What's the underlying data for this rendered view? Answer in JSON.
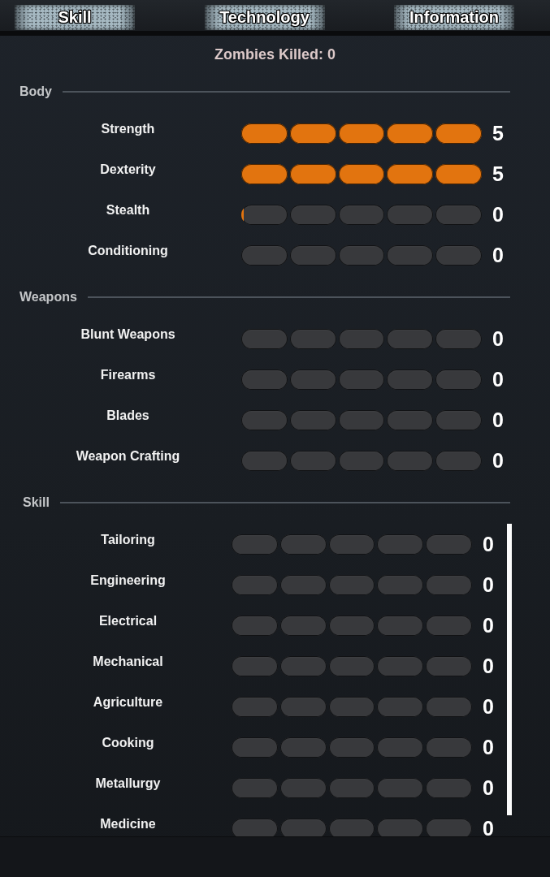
{
  "tabs": [
    {
      "label": "Skill"
    },
    {
      "label": "Technology"
    },
    {
      "label": "Information"
    }
  ],
  "zombies_killed": "Zombies Killed: 0",
  "sections": [
    {
      "title": "Body",
      "scrollbar": false,
      "skills": [
        {
          "name": "Strength",
          "stars": 5,
          "value": "5"
        },
        {
          "name": "Dexterity",
          "stars": 5,
          "value": "5"
        },
        {
          "name": "Stealth",
          "stars": 0,
          "level": 0.05,
          "value": "0"
        },
        {
          "name": "Conditioning",
          "stars": 0,
          "value": "0"
        }
      ]
    },
    {
      "title": "Weapons",
      "scrollbar": false,
      "skills": [
        {
          "name": "Blunt Weapons",
          "stars": 0,
          "value": "0"
        },
        {
          "name": "Firearms",
          "stars": 0,
          "value": "0"
        },
        {
          "name": "Blades",
          "stars": 0,
          "value": "0"
        },
        {
          "name": "Weapon Crafting",
          "stars": 0,
          "value": "0"
        }
      ]
    },
    {
      "title": "Skill",
      "scrollbar": true,
      "skills": [
        {
          "name": "Tailoring",
          "stars": 0,
          "value": "0"
        },
        {
          "name": "Engineering",
          "stars": 0,
          "value": "0"
        },
        {
          "name": "Electrical",
          "stars": 0,
          "value": "0"
        },
        {
          "name": "Mechanical",
          "stars": 0,
          "value": "0"
        },
        {
          "name": "Agriculture",
          "stars": 0,
          "value": "0"
        },
        {
          "name": "Cooking",
          "stars": 0,
          "value": "0"
        },
        {
          "name": "Metallurgy",
          "stars": 0,
          "value": "0"
        },
        {
          "name": "Medicine",
          "stars": 0,
          "value": "0"
        }
      ]
    }
  ]
}
